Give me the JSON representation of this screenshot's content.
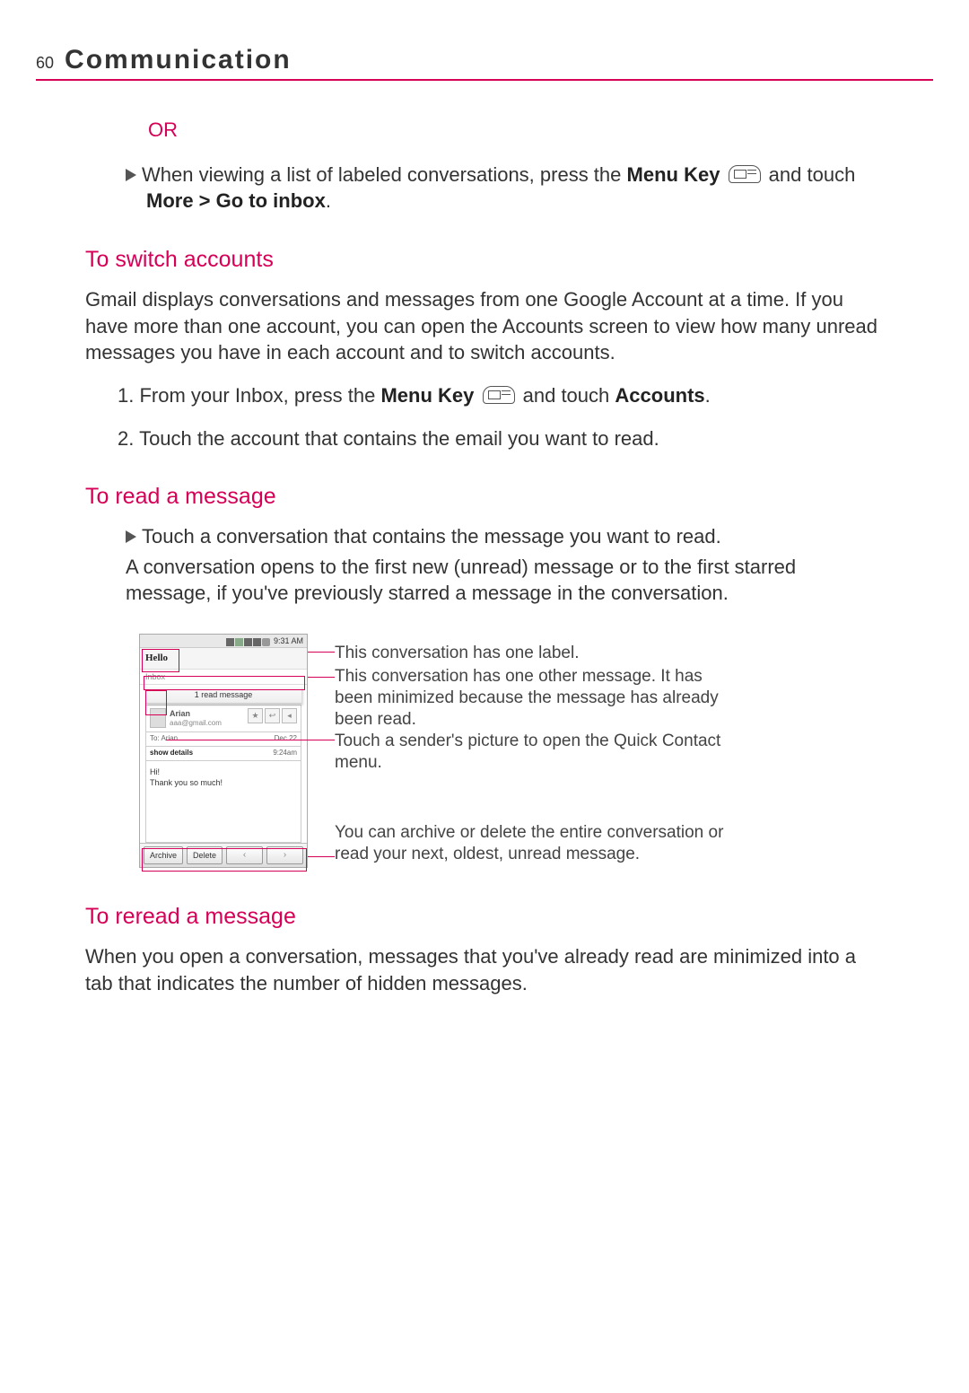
{
  "page_number": "60",
  "header_title": "Communication",
  "or_label": "OR",
  "intro_bullet": {
    "pre": "When viewing a list of labeled conversations, press the ",
    "bold1": "Menu Key",
    "mid": " and touch ",
    "bold2": "More > Go to inbox",
    "post": "."
  },
  "sections": {
    "switch": {
      "title": "To switch accounts",
      "body": "Gmail displays conversations and messages from one Google Account at a time. If you have more than one account, you can open the Accounts screen to view how many unread messages you have in each account and to switch accounts.",
      "steps": [
        {
          "pre": "From your Inbox, press the ",
          "bold1": "Menu Key",
          "mid": " and touch ",
          "bold2": "Accounts",
          "post": "."
        },
        {
          "text": "Touch the account that contains the email you want to read."
        }
      ]
    },
    "read": {
      "title": "To read a message",
      "bullet": "Touch a conversation that contains the message you want to read.",
      "body": "A conversation opens to the first new (unread) message or to the first starred message, if you've previously starred a message in the conversation."
    },
    "reread": {
      "title": "To reread a message",
      "body": "When you open a conversation, messages that you've already read are minimized into a tab that indicates the number of hidden messages."
    }
  },
  "screenshot": {
    "status_time": "9:31 AM",
    "subject": "Hello",
    "label": "Inbox",
    "read_bar": "1 read message",
    "sender_name": "Arian",
    "sender_email": "aaa@gmail.com",
    "to_line": "To: Arian",
    "date": "Dec 22",
    "show_details": "show details",
    "time": "9:24am",
    "body_line1": "Hi!",
    "body_line2": "Thank you so much!",
    "btn_archive": "Archive",
    "btn_delete": "Delete"
  },
  "callouts": {
    "c1": "This conversation has one label.",
    "c2": "This conversation has one other message. It has been minimized because the message has already been read.",
    "c3": "Touch a sender's picture to open the Quick Contact menu.",
    "c4": "You can archive or delete the entire conversation or read your next, oldest, unread message."
  }
}
